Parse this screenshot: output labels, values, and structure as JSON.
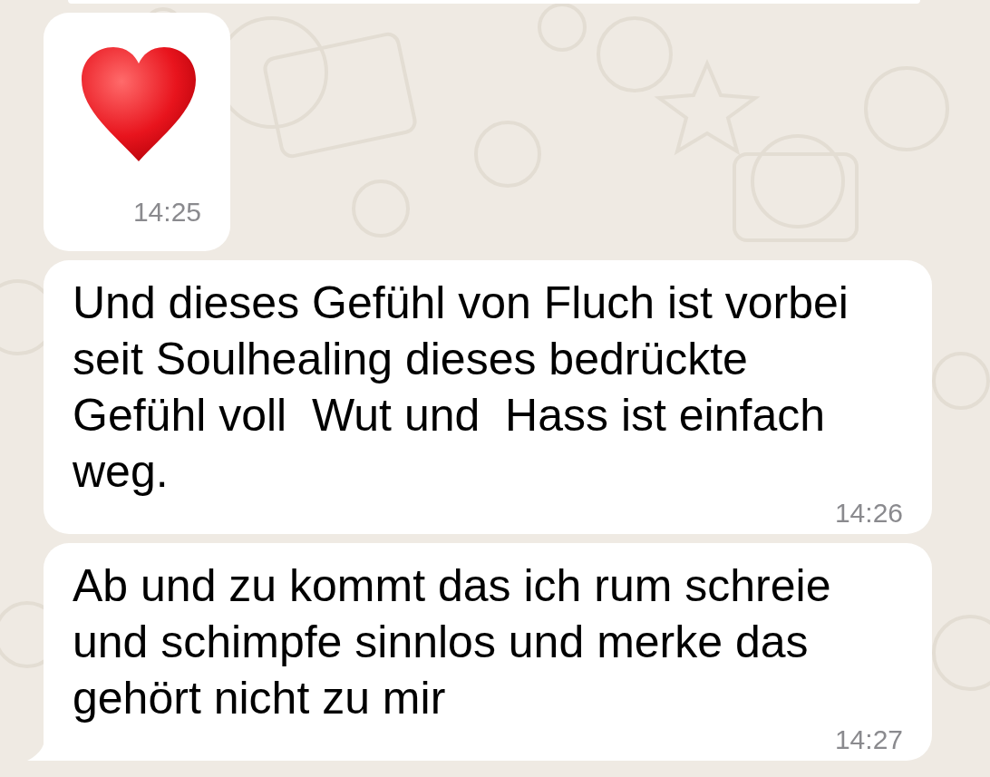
{
  "messages": [
    {
      "kind": "emoji",
      "time": "14:25",
      "tail": false
    },
    {
      "kind": "text",
      "text": "Und dieses Gefühl von Fluch ist vorbei seit Soulhealing dieses bedrückte Gefühl voll  Wut und  Hass ist einfach weg.",
      "time": "14:26",
      "tail": false
    },
    {
      "kind": "text",
      "text": "Ab und zu kommt das ich rum schreie und schimpfe sinnlos und merke das gehört nicht zu mir",
      "time": "14:27",
      "tail": true
    }
  ]
}
